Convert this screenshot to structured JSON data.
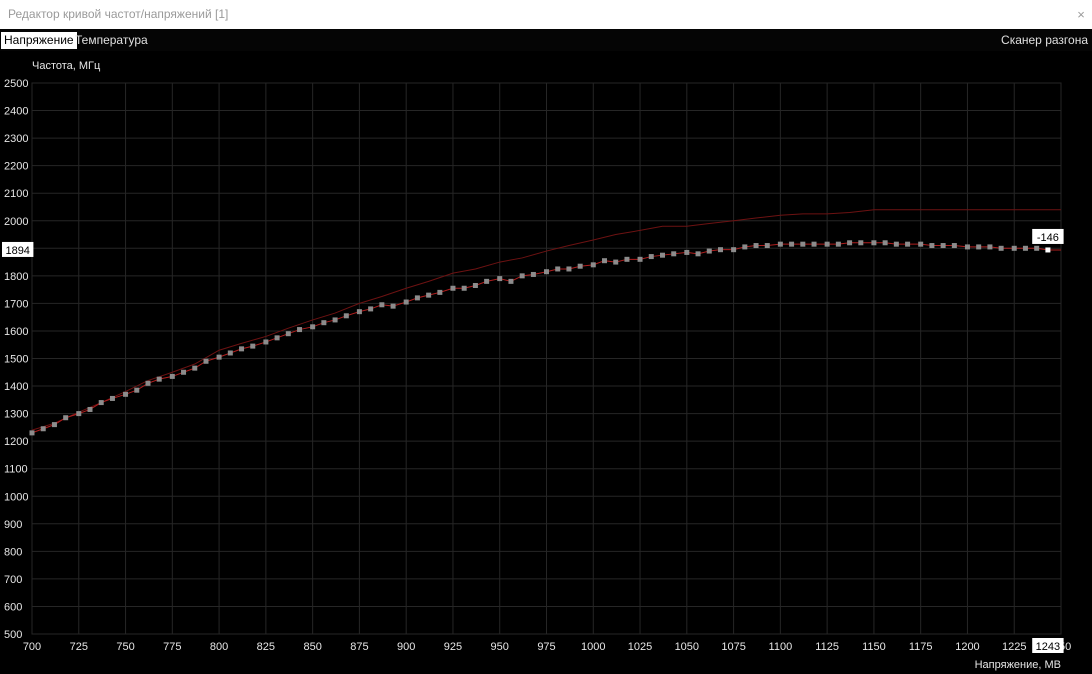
{
  "window": {
    "title": "Редактор кривой частот/напряжений [1]",
    "close_glyph": "×"
  },
  "tabs": [
    {
      "label": "Напряжение",
      "active": true
    },
    {
      "label": "Температура",
      "active": false
    }
  ],
  "scanner_label": "Сканер разгона",
  "chart_data": {
    "type": "scatter",
    "ylabel": "Частота, МГц",
    "xlabel": "Напряжение, МВ",
    "xlim": [
      700,
      1250
    ],
    "ylim": [
      500,
      2500
    ],
    "x_ticks": [
      700,
      725,
      750,
      775,
      800,
      825,
      850,
      875,
      900,
      925,
      950,
      975,
      1000,
      1025,
      1050,
      1075,
      1100,
      1125,
      1150,
      1175,
      1200,
      1225
    ],
    "x_tick_partial": "50",
    "y_ticks": [
      2500,
      2400,
      2300,
      2200,
      2100,
      2000,
      1900,
      1800,
      1700,
      1600,
      1500,
      1400,
      1300,
      1200,
      1100,
      1000,
      900,
      800,
      700,
      600,
      500
    ],
    "y_marker_label": "1894",
    "x_marker_label": "1243",
    "selected_offset_label": "-146",
    "grid": true,
    "colors": {
      "background": "#000000",
      "grid": "#262626",
      "upper_curve": "#6d1212",
      "curve": "#b01e1e",
      "point": "#8c8c8c",
      "selected": "#ffffff"
    },
    "series": [
      {
        "x": [
          700,
          706,
          712,
          718,
          725,
          731,
          737,
          743,
          750,
          756,
          762,
          768,
          775,
          781,
          787,
          793,
          800,
          806,
          812,
          818,
          825,
          831,
          837,
          843,
          850,
          856,
          862,
          868,
          875,
          881,
          887,
          893,
          900,
          906,
          912,
          918,
          925,
          931,
          937,
          943,
          950,
          956,
          962,
          968,
          975,
          981,
          987,
          993,
          1000,
          1006,
          1012,
          1018,
          1025,
          1031,
          1037,
          1043,
          1050,
          1056,
          1062,
          1068,
          1075,
          1081,
          1087,
          1093,
          1100,
          1106,
          1112,
          1118,
          1125,
          1131,
          1137,
          1143,
          1150,
          1156,
          1162,
          1168,
          1175,
          1181,
          1187,
          1193,
          1200,
          1206,
          1212,
          1218,
          1225,
          1231,
          1237,
          1243
        ],
        "y": [
          1230,
          1245,
          1260,
          1285,
          1300,
          1315,
          1340,
          1355,
          1370,
          1385,
          1410,
          1425,
          1435,
          1450,
          1465,
          1490,
          1505,
          1520,
          1535,
          1545,
          1560,
          1575,
          1590,
          1605,
          1615,
          1630,
          1640,
          1655,
          1670,
          1680,
          1695,
          1690,
          1705,
          1720,
          1730,
          1740,
          1755,
          1755,
          1765,
          1780,
          1790,
          1780,
          1800,
          1805,
          1815,
          1825,
          1825,
          1835,
          1840,
          1855,
          1850,
          1860,
          1860,
          1870,
          1875,
          1880,
          1885,
          1880,
          1890,
          1895,
          1895,
          1905,
          1910,
          1910,
          1915,
          1915,
          1915,
          1915,
          1915,
          1915,
          1920,
          1920,
          1920,
          1920,
          1915,
          1915,
          1915,
          1910,
          1910,
          1910,
          1905,
          1905,
          1905,
          1900,
          1900,
          1900,
          1900,
          1894
        ]
      },
      {
        "x": [
          700,
          712,
          725,
          737,
          750,
          762,
          775,
          787,
          800,
          812,
          825,
          837,
          850,
          862,
          875,
          887,
          900,
          912,
          925,
          937,
          950,
          962,
          975,
          987,
          1000,
          1012,
          1025,
          1037,
          1050,
          1062,
          1075,
          1087,
          1100,
          1112,
          1125,
          1137,
          1150,
          1162,
          1175,
          1187,
          1200,
          1212,
          1225,
          1237,
          1250
        ],
        "y": [
          1240,
          1265,
          1305,
          1340,
          1380,
          1420,
          1450,
          1480,
          1530,
          1555,
          1580,
          1610,
          1640,
          1665,
          1700,
          1725,
          1755,
          1780,
          1810,
          1825,
          1850,
          1865,
          1890,
          1910,
          1930,
          1950,
          1965,
          1980,
          1980,
          1990,
          2000,
          2010,
          2020,
          2025,
          2025,
          2030,
          2040,
          2040,
          2040,
          2040,
          2040,
          2040,
          2040,
          2040,
          2040
        ]
      }
    ]
  }
}
